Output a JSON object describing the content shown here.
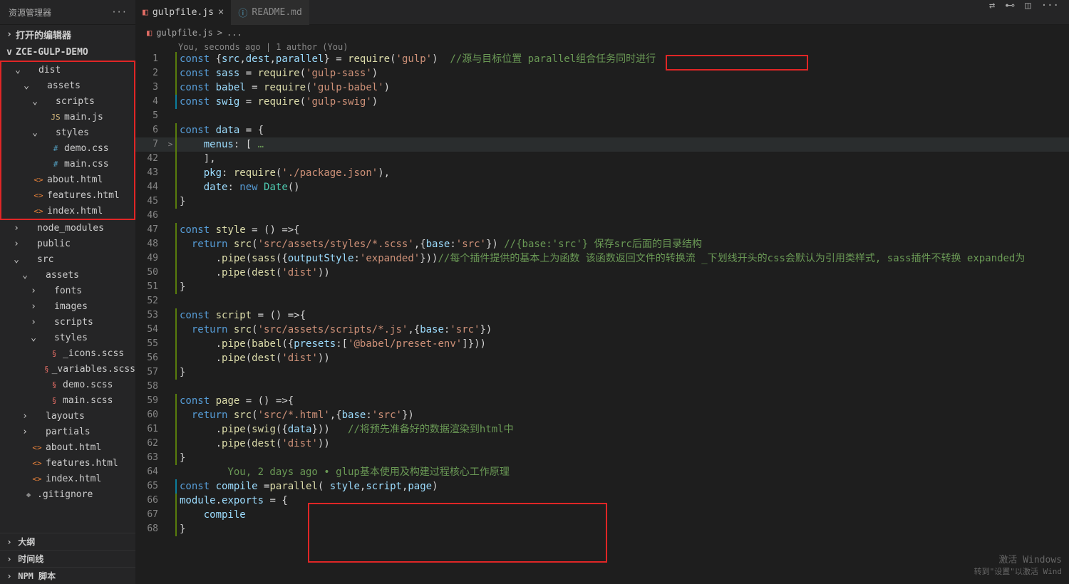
{
  "sidebar_title": "资源管理器",
  "open_editors": "打开的编辑器",
  "project_name": "ZCE-GULP-DEMO",
  "open_tab": {
    "name": "gulpfile.js",
    "close": "×"
  },
  "inactive_tab": {
    "name": "README.md"
  },
  "breadcrumb": {
    "file": "gulpfile.js",
    "sep": ">",
    "rest": "..."
  },
  "codelens": "You, seconds ago | 1 author (You)",
  "tree": [
    {
      "indent": 1,
      "chev": "v",
      "icon": "",
      "label": "dist",
      "col": ""
    },
    {
      "indent": 2,
      "chev": "v",
      "icon": "",
      "label": "assets",
      "col": ""
    },
    {
      "indent": 3,
      "chev": "v",
      "icon": "",
      "label": "scripts",
      "col": ""
    },
    {
      "indent": 4,
      "chev": "",
      "icon": "JS",
      "label": "main.js",
      "col": "yellow"
    },
    {
      "indent": 3,
      "chev": "v",
      "icon": "",
      "label": "styles",
      "col": ""
    },
    {
      "indent": 4,
      "chev": "",
      "icon": "#",
      "label": "demo.css",
      "col": "blue"
    },
    {
      "indent": 4,
      "chev": "",
      "icon": "#",
      "label": "main.css",
      "col": "blue"
    },
    {
      "indent": 2,
      "chev": "",
      "icon": "<>",
      "label": "about.html",
      "col": "orange"
    },
    {
      "indent": 2,
      "chev": "",
      "icon": "<>",
      "label": "features.html",
      "col": "orange"
    },
    {
      "indent": 2,
      "chev": "",
      "icon": "<>",
      "label": "index.html",
      "col": "orange"
    }
  ],
  "tree2": [
    {
      "indent": 1,
      "chev": ">",
      "icon": "",
      "label": "node_modules",
      "col": "grey"
    },
    {
      "indent": 1,
      "chev": ">",
      "icon": "",
      "label": "public",
      "col": ""
    },
    {
      "indent": 1,
      "chev": "v",
      "icon": "",
      "label": "src",
      "col": ""
    },
    {
      "indent": 2,
      "chev": "v",
      "icon": "",
      "label": "assets",
      "col": ""
    },
    {
      "indent": 3,
      "chev": ">",
      "icon": "",
      "label": "fonts",
      "col": ""
    },
    {
      "indent": 3,
      "chev": ">",
      "icon": "",
      "label": "images",
      "col": ""
    },
    {
      "indent": 3,
      "chev": ">",
      "icon": "",
      "label": "scripts",
      "col": ""
    },
    {
      "indent": 3,
      "chev": "v",
      "icon": "",
      "label": "styles",
      "col": ""
    },
    {
      "indent": 4,
      "chev": "",
      "icon": "§",
      "label": "_icons.scss",
      "col": "red"
    },
    {
      "indent": 4,
      "chev": "",
      "icon": "§",
      "label": "_variables.scss",
      "col": "red"
    },
    {
      "indent": 4,
      "chev": "",
      "icon": "§",
      "label": "demo.scss",
      "col": "red"
    },
    {
      "indent": 4,
      "chev": "",
      "icon": "§",
      "label": "main.scss",
      "col": "red"
    },
    {
      "indent": 2,
      "chev": ">",
      "icon": "",
      "label": "layouts",
      "col": ""
    },
    {
      "indent": 2,
      "chev": ">",
      "icon": "",
      "label": "partials",
      "col": ""
    },
    {
      "indent": 2,
      "chev": "",
      "icon": "<>",
      "label": "about.html",
      "col": "orange"
    },
    {
      "indent": 2,
      "chev": "",
      "icon": "<>",
      "label": "features.html",
      "col": "orange"
    },
    {
      "indent": 2,
      "chev": "",
      "icon": "<>",
      "label": "index.html",
      "col": "orange"
    },
    {
      "indent": 1,
      "chev": "",
      "icon": "◆",
      "label": ".gitignore",
      "col": "grey"
    }
  ],
  "panels": [
    "大纲",
    "时间线",
    "NPM 脚本"
  ],
  "watermark": {
    "line1": "激活 Windows",
    "line2": "转到\"设置\"以激活 Wind"
  },
  "code": [
    {
      "n": 1,
      "bar": "",
      "txt": [
        [
          "kw",
          "const"
        ],
        [
          "pun",
          " {"
        ],
        [
          "var",
          "src"
        ],
        [
          "pun",
          ","
        ],
        [
          "var",
          "dest"
        ],
        [
          "pun",
          ","
        ],
        [
          "var",
          "parallel"
        ],
        [
          "pun",
          "} = "
        ],
        [
          "fn",
          "require"
        ],
        [
          "pun",
          "("
        ],
        [
          "str",
          "'gulp'"
        ],
        [
          "pun",
          ")  "
        ],
        [
          "com",
          "//源与目标位置 parallel组合任务同时进行"
        ]
      ]
    },
    {
      "n": 2,
      "bar": "",
      "txt": [
        [
          "kw",
          "const"
        ],
        [
          "pun",
          " "
        ],
        [
          "var",
          "sass"
        ],
        [
          "pun",
          " = "
        ],
        [
          "fn",
          "require"
        ],
        [
          "pun",
          "("
        ],
        [
          "str",
          "'gulp-sass'"
        ],
        [
          "pun",
          ")"
        ]
      ]
    },
    {
      "n": 3,
      "bar": "",
      "txt": [
        [
          "kw",
          "const"
        ],
        [
          "pun",
          " "
        ],
        [
          "var",
          "babel"
        ],
        [
          "pun",
          " = "
        ],
        [
          "fn",
          "require"
        ],
        [
          "pun",
          "("
        ],
        [
          "str",
          "'gulp-babel'"
        ],
        [
          "pun",
          ")"
        ]
      ]
    },
    {
      "n": 4,
      "bar": "mod",
      "txt": [
        [
          "kw",
          "const"
        ],
        [
          "pun",
          " "
        ],
        [
          "var",
          "swig"
        ],
        [
          "pun",
          " = "
        ],
        [
          "fn",
          "require"
        ],
        [
          "pun",
          "("
        ],
        [
          "str",
          "'gulp-swig'"
        ],
        [
          "pun",
          ")"
        ]
      ]
    },
    {
      "n": 5,
      "bar": "none",
      "txt": []
    },
    {
      "n": 6,
      "bar": "",
      "txt": [
        [
          "kw",
          "const"
        ],
        [
          "pun",
          " "
        ],
        [
          "var",
          "data"
        ],
        [
          "pun",
          " = {"
        ]
      ]
    },
    {
      "n": 7,
      "bar": "",
      "cur": true,
      "fold": ">",
      "txt": [
        [
          "pun",
          "    "
        ],
        [
          "var",
          "menus"
        ],
        [
          "pun",
          ": [ "
        ],
        [
          "com",
          "…"
        ]
      ]
    },
    {
      "n": 42,
      "bar": "",
      "txt": [
        [
          "pun",
          "    ],"
        ]
      ]
    },
    {
      "n": 43,
      "bar": "",
      "txt": [
        [
          "pun",
          "    "
        ],
        [
          "var",
          "pkg"
        ],
        [
          "pun",
          ": "
        ],
        [
          "fn",
          "require"
        ],
        [
          "pun",
          "("
        ],
        [
          "str",
          "'./package.json'"
        ],
        [
          "pun",
          "),"
        ]
      ]
    },
    {
      "n": 44,
      "bar": "",
      "txt": [
        [
          "pun",
          "    "
        ],
        [
          "var",
          "date"
        ],
        [
          "pun",
          ": "
        ],
        [
          "kw",
          "new"
        ],
        [
          "pun",
          " "
        ],
        [
          "cls",
          "Date"
        ],
        [
          "pun",
          "()"
        ]
      ]
    },
    {
      "n": 45,
      "bar": "",
      "txt": [
        [
          "pun",
          "}"
        ]
      ]
    },
    {
      "n": 46,
      "bar": "none",
      "txt": []
    },
    {
      "n": 47,
      "bar": "",
      "txt": [
        [
          "kw",
          "const"
        ],
        [
          "pun",
          " "
        ],
        [
          "fn",
          "style"
        ],
        [
          "pun",
          " = () =>{"
        ]
      ]
    },
    {
      "n": 48,
      "bar": "",
      "txt": [
        [
          "pun",
          "  "
        ],
        [
          "kw",
          "return"
        ],
        [
          "pun",
          " "
        ],
        [
          "fn",
          "src"
        ],
        [
          "pun",
          "("
        ],
        [
          "str",
          "'src/assets/styles/*.scss'"
        ],
        [
          "pun",
          ",{"
        ],
        [
          "var",
          "base"
        ],
        [
          "pun",
          ":"
        ],
        [
          "str",
          "'src'"
        ],
        [
          "pun",
          "}) "
        ],
        [
          "com",
          "//{base:'src'} 保存src后面的目录结构"
        ]
      ]
    },
    {
      "n": 49,
      "bar": "",
      "txt": [
        [
          "pun",
          "      ."
        ],
        [
          "fn",
          "pipe"
        ],
        [
          "pun",
          "("
        ],
        [
          "fn",
          "sass"
        ],
        [
          "pun",
          "({"
        ],
        [
          "var",
          "outputStyle"
        ],
        [
          "pun",
          ":"
        ],
        [
          "str",
          "'expanded'"
        ],
        [
          "pun",
          "}))"
        ],
        [
          "com",
          "//每个插件提供的基本上为函数 该函数返回文件的转换流 _下划线开头的css会默认为引用类样式, sass插件不转换 expanded为"
        ]
      ]
    },
    {
      "n": 50,
      "bar": "",
      "txt": [
        [
          "pun",
          "      ."
        ],
        [
          "fn",
          "pipe"
        ],
        [
          "pun",
          "("
        ],
        [
          "fn",
          "dest"
        ],
        [
          "pun",
          "("
        ],
        [
          "str",
          "'dist'"
        ],
        [
          "pun",
          "))"
        ]
      ]
    },
    {
      "n": 51,
      "bar": "",
      "txt": [
        [
          "pun",
          "}"
        ]
      ]
    },
    {
      "n": 52,
      "bar": "none",
      "txt": []
    },
    {
      "n": 53,
      "bar": "",
      "txt": [
        [
          "kw",
          "const"
        ],
        [
          "pun",
          " "
        ],
        [
          "fn",
          "script"
        ],
        [
          "pun",
          " = () =>{"
        ]
      ]
    },
    {
      "n": 54,
      "bar": "",
      "txt": [
        [
          "pun",
          "  "
        ],
        [
          "kw",
          "return"
        ],
        [
          "pun",
          " "
        ],
        [
          "fn",
          "src"
        ],
        [
          "pun",
          "("
        ],
        [
          "str",
          "'src/assets/scripts/*.js'"
        ],
        [
          "pun",
          ",{"
        ],
        [
          "var",
          "base"
        ],
        [
          "pun",
          ":"
        ],
        [
          "str",
          "'src'"
        ],
        [
          "pun",
          "})"
        ]
      ]
    },
    {
      "n": 55,
      "bar": "",
      "txt": [
        [
          "pun",
          "      ."
        ],
        [
          "fn",
          "pipe"
        ],
        [
          "pun",
          "("
        ],
        [
          "fn",
          "babel"
        ],
        [
          "pun",
          "({"
        ],
        [
          "var",
          "presets"
        ],
        [
          "pun",
          ":["
        ],
        [
          "str",
          "'@babel/preset-env'"
        ],
        [
          "pun",
          "]}))"
        ]
      ]
    },
    {
      "n": 56,
      "bar": "",
      "txt": [
        [
          "pun",
          "      ."
        ],
        [
          "fn",
          "pipe"
        ],
        [
          "pun",
          "("
        ],
        [
          "fn",
          "dest"
        ],
        [
          "pun",
          "("
        ],
        [
          "str",
          "'dist'"
        ],
        [
          "pun",
          "))"
        ]
      ]
    },
    {
      "n": 57,
      "bar": "",
      "txt": [
        [
          "pun",
          "}"
        ]
      ]
    },
    {
      "n": 58,
      "bar": "none",
      "txt": []
    },
    {
      "n": 59,
      "bar": "",
      "txt": [
        [
          "kw",
          "const"
        ],
        [
          "pun",
          " "
        ],
        [
          "fn",
          "page"
        ],
        [
          "pun",
          " = () =>{"
        ]
      ]
    },
    {
      "n": 60,
      "bar": "",
      "txt": [
        [
          "pun",
          "  "
        ],
        [
          "kw",
          "return"
        ],
        [
          "pun",
          " "
        ],
        [
          "fn",
          "src"
        ],
        [
          "pun",
          "("
        ],
        [
          "str",
          "'src/*.html'"
        ],
        [
          "pun",
          ",{"
        ],
        [
          "var",
          "base"
        ],
        [
          "pun",
          ":"
        ],
        [
          "str",
          "'src'"
        ],
        [
          "pun",
          "})"
        ]
      ]
    },
    {
      "n": 61,
      "bar": "",
      "txt": [
        [
          "pun",
          "      ."
        ],
        [
          "fn",
          "pipe"
        ],
        [
          "pun",
          "("
        ],
        [
          "fn",
          "swig"
        ],
        [
          "pun",
          "({"
        ],
        [
          "var",
          "data"
        ],
        [
          "pun",
          "}))   "
        ],
        [
          "com",
          "//将预先准备好的数据渲染到html中"
        ]
      ]
    },
    {
      "n": 62,
      "bar": "",
      "txt": [
        [
          "pun",
          "      ."
        ],
        [
          "fn",
          "pipe"
        ],
        [
          "pun",
          "("
        ],
        [
          "fn",
          "dest"
        ],
        [
          "pun",
          "("
        ],
        [
          "str",
          "'dist'"
        ],
        [
          "pun",
          "))"
        ]
      ]
    },
    {
      "n": 63,
      "bar": "",
      "txt": [
        [
          "pun",
          "}"
        ]
      ]
    },
    {
      "n": 64,
      "bar": "none",
      "txt": [
        [
          "com",
          "        You, 2 days ago • glup基本使用及构建过程核心工作原理"
        ]
      ]
    },
    {
      "n": 65,
      "bar": "mod",
      "txt": [
        [
          "kw",
          "const"
        ],
        [
          "pun",
          " "
        ],
        [
          "var",
          "compile"
        ],
        [
          "pun",
          " ="
        ],
        [
          "fn",
          "parallel"
        ],
        [
          "pun",
          "( "
        ],
        [
          "var",
          "style"
        ],
        [
          "pun",
          ","
        ],
        [
          "var",
          "script"
        ],
        [
          "pun",
          ","
        ],
        [
          "var",
          "page"
        ],
        [
          "pun",
          ")"
        ]
      ]
    },
    {
      "n": 66,
      "bar": "",
      "txt": [
        [
          "var",
          "module"
        ],
        [
          "pun",
          "."
        ],
        [
          "var",
          "exports"
        ],
        [
          "pun",
          " = {"
        ]
      ]
    },
    {
      "n": 67,
      "bar": "",
      "txt": [
        [
          "pun",
          "    "
        ],
        [
          "var",
          "compile"
        ]
      ]
    },
    {
      "n": 68,
      "bar": "",
      "txt": [
        [
          "pun",
          "}"
        ]
      ]
    }
  ]
}
